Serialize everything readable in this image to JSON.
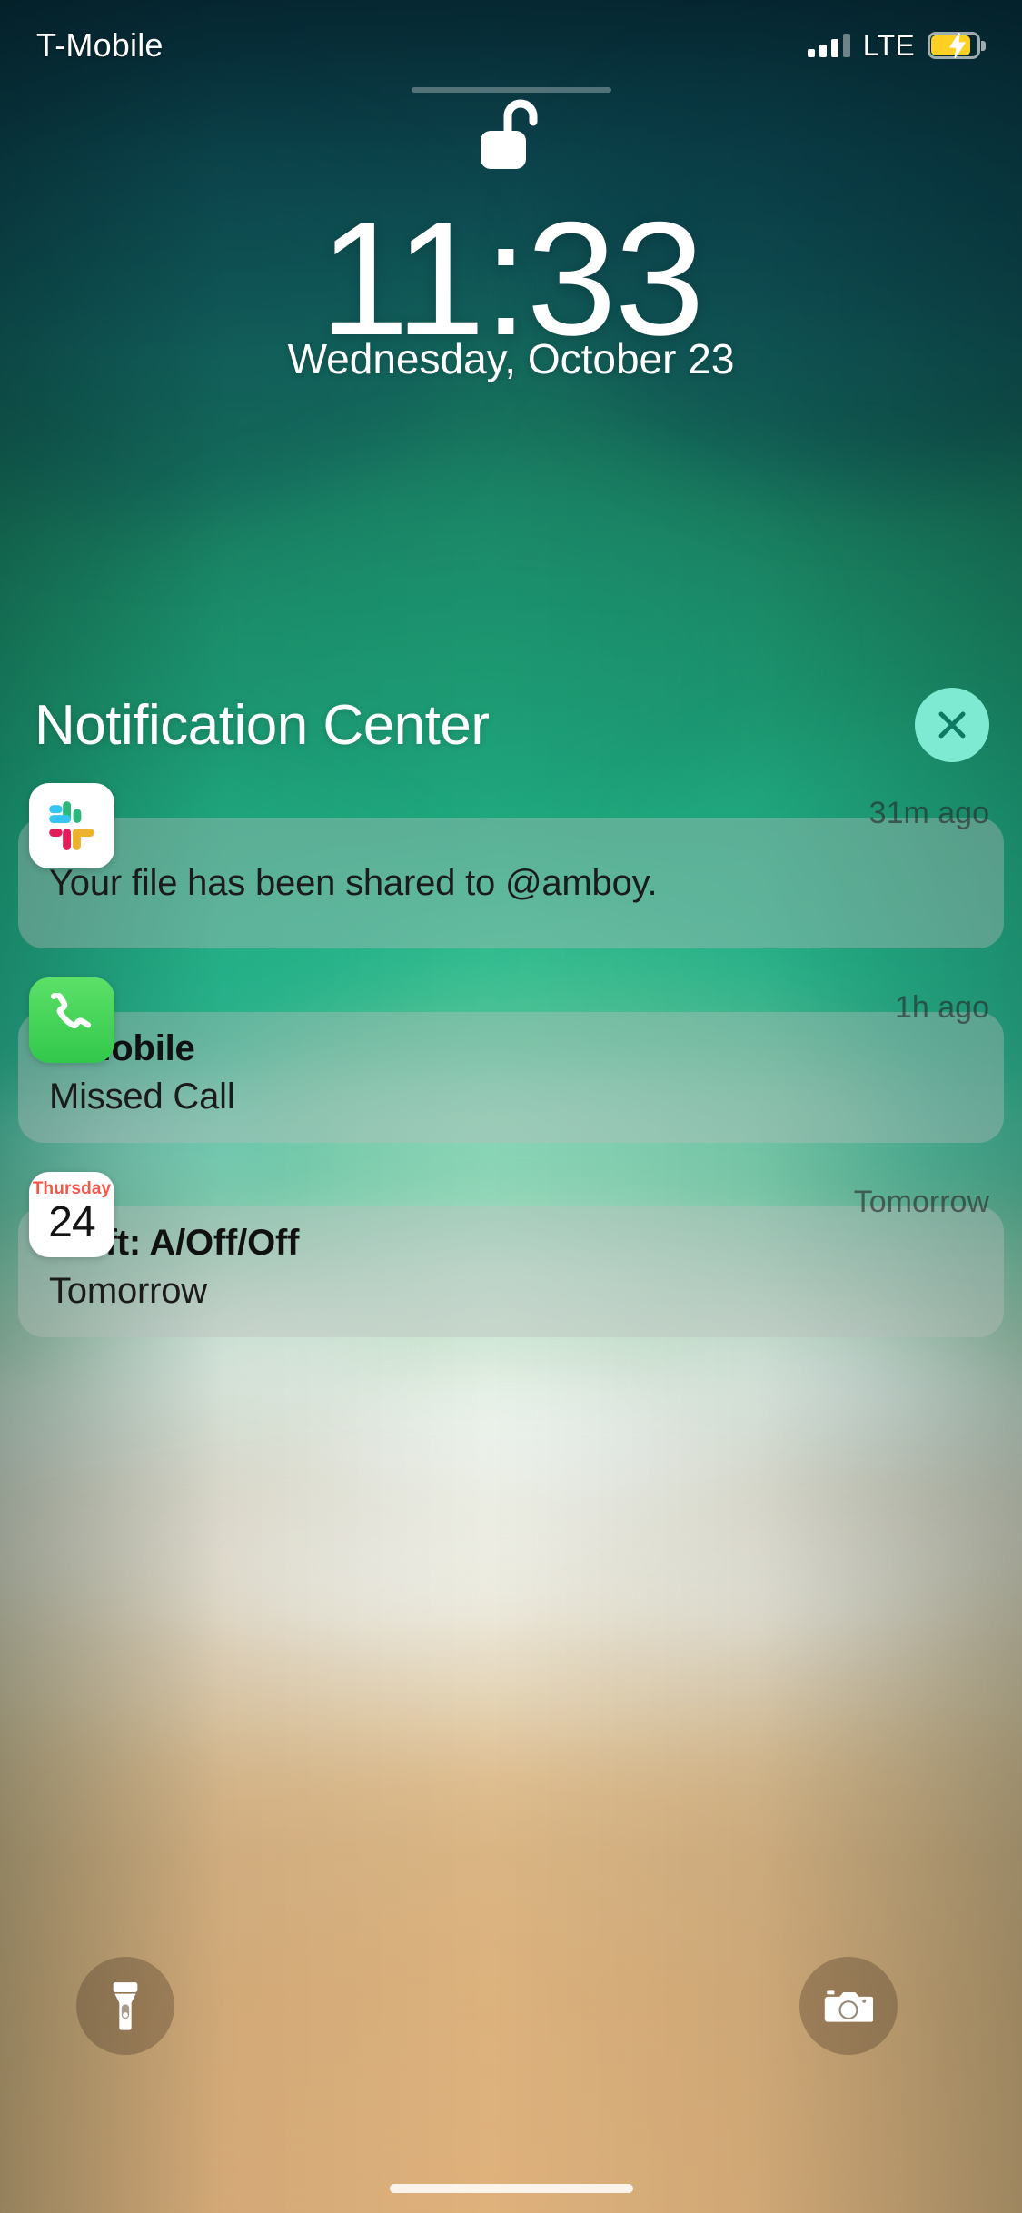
{
  "status_bar": {
    "carrier": "T-Mobile",
    "network_type": "LTE",
    "signal_bars_filled": 3,
    "signal_bars_total": 4,
    "battery_charging": true,
    "battery_color": "#fdd023",
    "battery_icon": "battery-charging-icon"
  },
  "lock": {
    "icon": "unlocked-padlock-icon",
    "state": "unlocked"
  },
  "clock": {
    "time": "11:33",
    "date": "Wednesday, October 23"
  },
  "notification_center": {
    "title": "Notification Center",
    "close_label": "×",
    "close_icon": "close-x-icon",
    "close_button_color": "#7fead2",
    "notifications": [
      {
        "app": "Slack",
        "icon": "slack-app-icon",
        "title": "",
        "body": "Your file has been shared to @amboy.",
        "time": "31m ago",
        "single_line": true
      },
      {
        "app": "Phone",
        "icon": "phone-app-icon",
        "title": "T Mobile",
        "body": "Missed Call",
        "time": "1h ago",
        "single_line": false
      },
      {
        "app": "Calendar",
        "icon": "calendar-app-icon",
        "calendar_weekday": "Thursday",
        "calendar_day": "24",
        "title": "Shift: A/Off/Off",
        "body": "Tomorrow",
        "time": "Tomorrow",
        "single_line": false
      }
    ]
  },
  "quick_actions": {
    "left": {
      "name": "Flashlight",
      "icon": "flashlight-icon"
    },
    "right": {
      "name": "Camera",
      "icon": "camera-icon"
    }
  },
  "home_indicator": {
    "visible": true
  }
}
